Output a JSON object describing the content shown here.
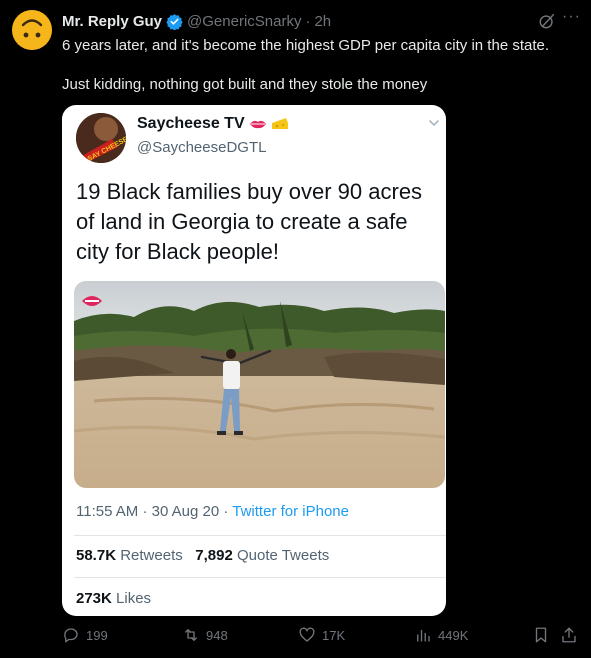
{
  "tweet": {
    "author_name": "Mr. Reply Guy",
    "handle": "@GenericSnarky",
    "separator": "·",
    "time": "2h",
    "more_label": "···",
    "text_line1": "6 years later, and it's become the highest GDP per capita city in the state.",
    "text_line2": "Just kidding, nothing got built and they stole the money"
  },
  "quoted": {
    "author_name": "Saycheese TV",
    "handle": "@SaycheeseDGTL",
    "avatar_text": "SAY CHEESE",
    "text": "19 Black families buy over 90 acres of land in Georgia to create a safe city for Black people!",
    "time": "11:55 AM",
    "separator": "·",
    "date": "30 Aug 20",
    "source": "Twitter for iPhone",
    "retweets_count": "58.7K",
    "retweets_label": "Retweets",
    "quotes_count": "7,892",
    "quotes_label": "Quote Tweets",
    "likes_count": "273K",
    "likes_label": "Likes"
  },
  "actions": {
    "replies": "199",
    "reposts": "948",
    "likes": "17K",
    "views": "449K"
  },
  "colors": {
    "background": "#000000",
    "accent": "#1d9bf0",
    "muted": "#71767b"
  }
}
